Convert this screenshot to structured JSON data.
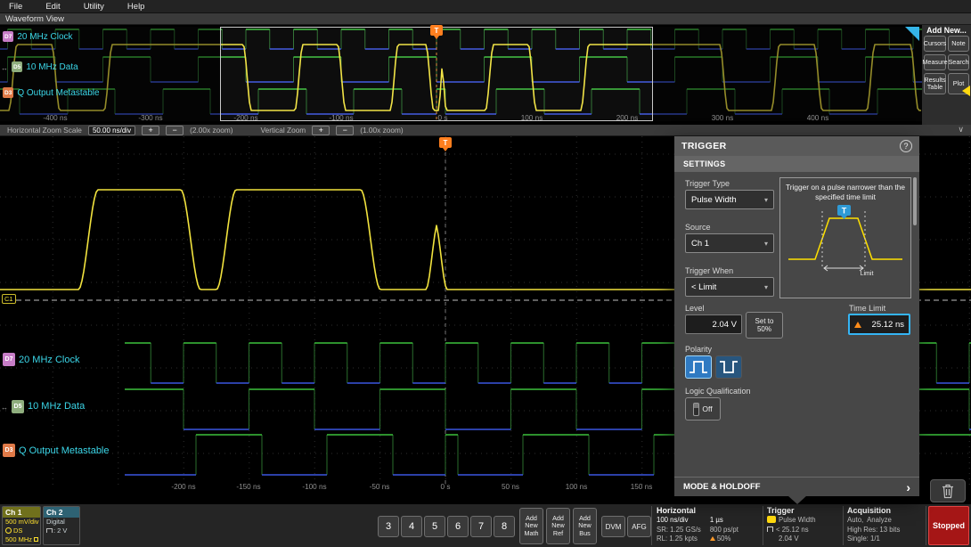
{
  "colors": {
    "ch1": "#f2e33e",
    "digital_high": "#3cc13c",
    "digital_low": "#3a55e0",
    "trigger_orange": "#ff7f1f",
    "label_cyan": "#3bd6e8",
    "accent_blue": "#35b5f5",
    "stopped_red": "#a51616"
  },
  "menubar": {
    "items": [
      {
        "label": "File"
      },
      {
        "label": "Edit"
      },
      {
        "label": "Utility"
      },
      {
        "label": "Help"
      }
    ]
  },
  "view_tab": {
    "label": "Waveform View"
  },
  "channels": [
    {
      "badge": "D7",
      "label": "20 MHz Clock",
      "color": "#c77dc7"
    },
    {
      "badge": "D5",
      "label": "10 MHz Data",
      "color": "#8fae7e"
    },
    {
      "badge": "D3",
      "label": "Q Output Metastable",
      "color": "#e07a48"
    }
  ],
  "overview": {
    "time_labels": [
      "-400 ns",
      "-300 ns",
      "-200 ns",
      "-100 ns",
      "0 s",
      "100 ns",
      "200 ns",
      "300 ns",
      "400 ns"
    ],
    "trigger_marker": "T"
  },
  "add_new_panel": {
    "title": "Add New...",
    "buttons": [
      {
        "label": "Cursors"
      },
      {
        "label": "Note"
      },
      {
        "label": "Measure"
      },
      {
        "label": "Search"
      },
      {
        "label": "Results Table"
      },
      {
        "label": "Plot"
      }
    ]
  },
  "zoom_bar": {
    "horizontal_label": "Horizontal Zoom Scale",
    "horizontal_value": "50.00 ns/div",
    "plus": "+",
    "minus": "−",
    "horizontal_zoom": "(2.00x zoom)",
    "vertical_label": "Vertical Zoom",
    "vertical_zoom": "(1.00x zoom)"
  },
  "main_view": {
    "time_labels": [
      "-200 ns",
      "-150 ns",
      "-100 ns",
      "-50 ns",
      "0 s",
      "50 ns",
      "100 ns",
      "150 ns"
    ],
    "trigger_marker": "T",
    "level_tag": "C1"
  },
  "trigger_panel": {
    "title": "TRIGGER",
    "help": "?",
    "section": "SETTINGS",
    "trigger_type_label": "Trigger Type",
    "trigger_type_value": "Pulse Width",
    "description": "Trigger on a pulse narrower than the specified time limit",
    "source_label": "Source",
    "source_value": "Ch 1",
    "trigger_when_label": "Trigger When",
    "trigger_when_value": "< Limit",
    "level_label": "Level",
    "level_value": "2.04 V",
    "set_to_line1": "Set to",
    "set_to_line2": "50%",
    "time_limit_label": "Time Limit",
    "time_limit_value": "25.12 ns",
    "polarity_label": "Polarity",
    "logic_label": "Logic Qualification",
    "logic_value": "Off",
    "diagram_limit": "Limit",
    "diagram_marker": "T",
    "footer_label": "MODE & HOLDOFF"
  },
  "bottom_bar": {
    "ch1": {
      "name": "Ch 1",
      "line1": "500 mV/div",
      "line2": "DS",
      "line3": "500 MHz"
    },
    "ch2": {
      "name": "Ch 2",
      "line1": "Digital",
      "line2": ": 2 V"
    },
    "channel_buttons": [
      "3",
      "4",
      "5",
      "6",
      "7",
      "8"
    ],
    "add_buttons": [
      {
        "label": "Add New Math"
      },
      {
        "label": "Add New Ref"
      },
      {
        "label": "Add New Bus"
      }
    ],
    "dvm": "DVM",
    "afg": "AFG",
    "horizontal": {
      "title": "Horizontal",
      "scale": "100 ns/div",
      "duration": "1 µs",
      "sample_rate": "SR: 1.25 GS/s",
      "resolution": "800 ps/pt",
      "record_length": "RL: 1.25 kpts",
      "position": "50%"
    },
    "trigger": {
      "title": "Trigger",
      "type": "Pulse Width",
      "condition": "< 25.12 ns",
      "level": "2.04 V"
    },
    "acquisition": {
      "title": "Acquisition",
      "mode": "Auto,  Analyze",
      "detail": "High Res: 13 bits",
      "single": "Single: 1/1"
    },
    "stopped": "Stopped"
  }
}
